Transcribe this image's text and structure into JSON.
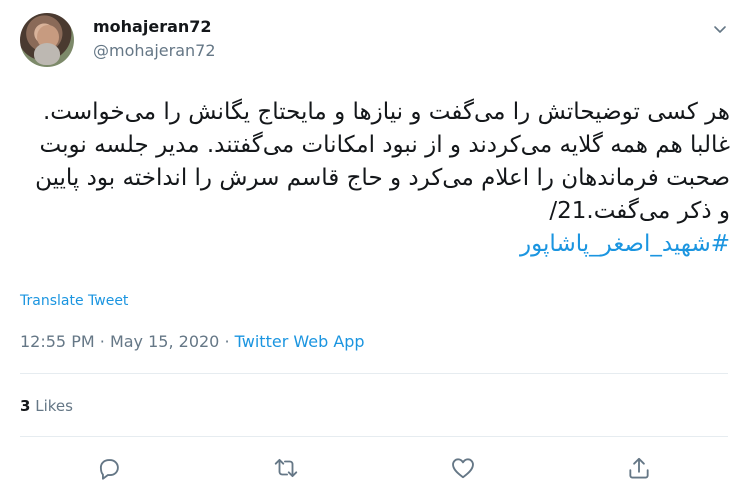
{
  "author": {
    "display_name": "mohajeran72",
    "handle": "@mohajeran72"
  },
  "tweet": {
    "text": "هر کسی توضیحاتش را می‌گفت و نیازها و مایحتاج یگانش را می‌خواست. غالبا هم همه گلایه می‌کردند و از نبود امکانات می‌گفتند. مدیر جلسه نوبت صحبت فرماندهان را اعلام می‌کرد و حاج قاسم سرش را انداخته بود پایین و ذکر می‌گفت.21/",
    "hashtag": "#شهید_اصغر_پاشاپور",
    "translate_label": "Translate Tweet"
  },
  "meta": {
    "time": "12:55 PM",
    "separator1": "·",
    "date": "May 15, 2020",
    "separator2": "·",
    "source": "Twitter Web App"
  },
  "stats": {
    "likes_count": "3",
    "likes_label": "Likes"
  },
  "icons": {
    "header": "chevron-down-icon",
    "actions": [
      "reply-icon",
      "retweet-icon",
      "like-icon",
      "share-icon"
    ]
  },
  "colors": {
    "link": "#1b95e0",
    "secondary_text": "#657786",
    "icon": "#657786"
  }
}
